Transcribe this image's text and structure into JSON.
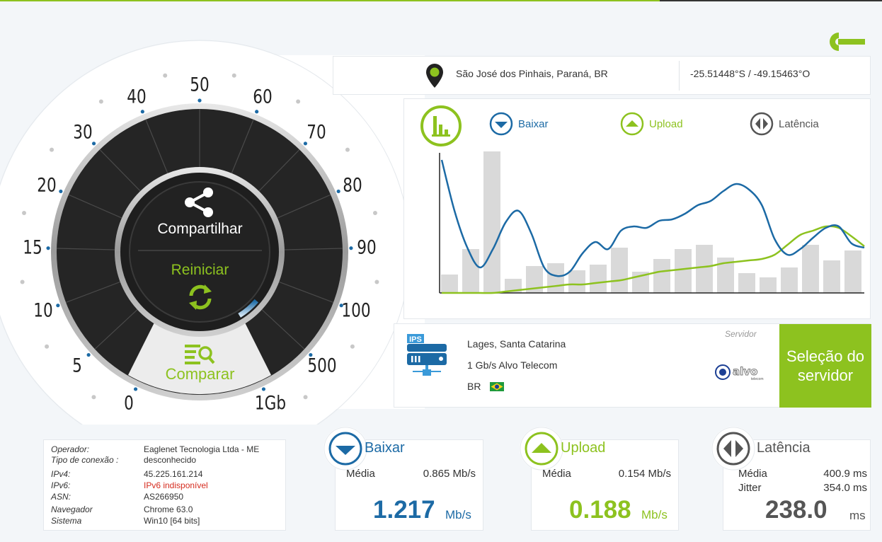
{
  "colors": {
    "accent": "#8dc21f",
    "download": "#1c6aa5",
    "latency": "#555555",
    "dark": "#252525"
  },
  "gauge": {
    "scale_labels": [
      "0",
      "5",
      "10",
      "15",
      "20",
      "30",
      "40",
      "50",
      "60",
      "70",
      "80",
      "90",
      "100",
      "500",
      "1Gb"
    ],
    "progress_fraction": 0.12,
    "share_label": "Compartilhar",
    "restart_label": "Reiniciar",
    "compare_label": "Comparar"
  },
  "location": {
    "city": "São José dos Pinhais, Paraná, BR",
    "coords": "-25.51448°S / -49.15463°O"
  },
  "chart": {
    "legend": {
      "download": "Baixar",
      "upload": "Upload",
      "latency": "Latência"
    }
  },
  "chart_data": {
    "type": "line",
    "title": "",
    "xlabel": "",
    "ylabel": "",
    "bars_label": "Latência",
    "bars": [
      0.13,
      0.31,
      1.0,
      0.1,
      0.19,
      0.21,
      0.16,
      0.2,
      0.32,
      0.15,
      0.24,
      0.31,
      0.34,
      0.25,
      0.14,
      0.11,
      0.18,
      0.34,
      0.23,
      0.3
    ],
    "series": [
      {
        "name": "Baixar",
        "color": "#1c6aa5",
        "values": [
          0.94,
          0.58,
          0.32,
          0.18,
          0.31,
          0.5,
          0.58,
          0.42,
          0.18,
          0.12,
          0.15,
          0.28,
          0.36,
          0.31,
          0.44,
          0.47,
          0.46,
          0.51,
          0.52,
          0.56,
          0.62,
          0.65,
          0.72,
          0.77,
          0.73,
          0.62,
          0.38,
          0.27,
          0.31,
          0.39,
          0.46,
          0.47,
          0.35,
          0.32
        ]
      },
      {
        "name": "Upload",
        "color": "#8dc21f",
        "values": [
          0.0,
          0.0,
          0.0,
          0.0,
          0.0,
          0.01,
          0.02,
          0.03,
          0.04,
          0.05,
          0.06,
          0.06,
          0.07,
          0.08,
          0.09,
          0.11,
          0.13,
          0.15,
          0.16,
          0.17,
          0.18,
          0.19,
          0.21,
          0.22,
          0.23,
          0.24,
          0.27,
          0.34,
          0.41,
          0.44,
          0.47,
          0.46,
          0.4,
          0.33
        ]
      }
    ]
  },
  "server": {
    "icon_label": "IPS",
    "caption": "Servidor",
    "city": "Lages, Santa Catarina",
    "speed_provider": "1 Gb/s Alvo Telecom",
    "country": "BR",
    "logo_text": "alvo",
    "logo_sub": "telecom",
    "select_line1": "Seleção do",
    "select_line2": "servidor"
  },
  "info": [
    {
      "key": "Operador:",
      "value": "Eaglenet Tecnologia Ltda - ME"
    },
    {
      "key": "Tipo de conexão :",
      "value": "desconhecido"
    },
    {
      "key": "IPv4:",
      "value": "45.225.161.214"
    },
    {
      "key": "IPv6:",
      "value": "IPv6 indisponível"
    },
    {
      "key": "ASN:",
      "value": "AS266950"
    },
    {
      "key": "Navegador",
      "value": "Chrome 63.0"
    },
    {
      "key": "Sistema",
      "value": "Win10 [64 bits]"
    }
  ],
  "results": {
    "download": {
      "title": "Baixar",
      "avg_label": "Média",
      "avg_value": "0.865 Mb/s",
      "value": "1.217",
      "unit": "Mb/s"
    },
    "upload": {
      "title": "Upload",
      "avg_label": "Média",
      "avg_value": "0.154 Mb/s",
      "value": "0.188",
      "unit": "Mb/s"
    },
    "latency": {
      "title": "Latência",
      "avg_label": "Média",
      "avg_value": "400.9 ms",
      "jitter_label": "Jitter",
      "jitter_value": "354.0 ms",
      "value": "238.0",
      "unit": "ms"
    }
  }
}
